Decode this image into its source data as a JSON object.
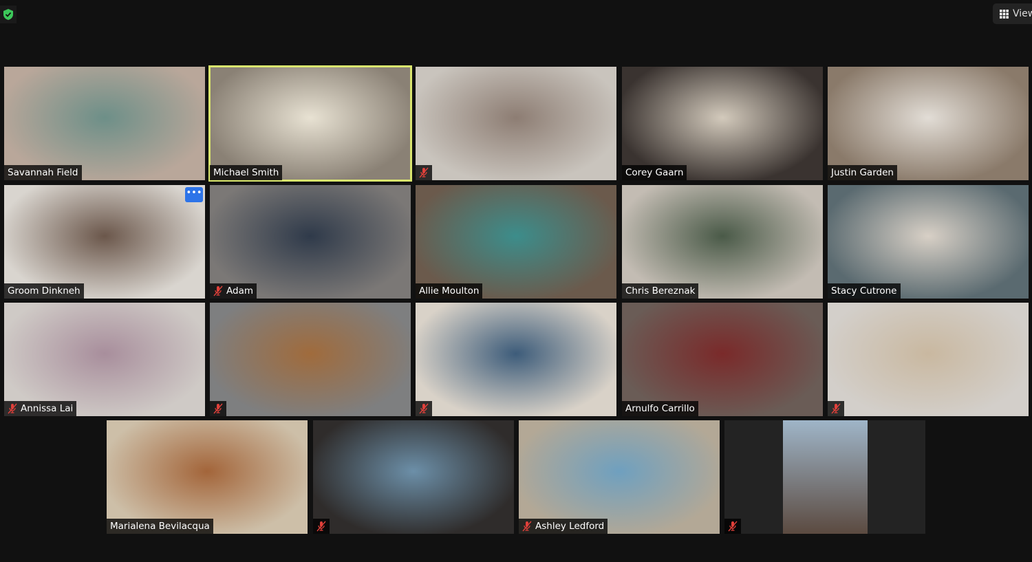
{
  "header": {
    "view_label": "View",
    "security_icon": "shield-check-icon",
    "view_icon": "grid-icon"
  },
  "colors": {
    "active_speaker": "#d9e56e",
    "muted": "#e0403a",
    "more_button": "#2d74e8",
    "shield": "#3cc85a"
  },
  "participants": [
    {
      "name": "Savannah Field",
      "muted": false,
      "bg": [
        "#b9a79a",
        "#6d8f88"
      ]
    },
    {
      "name": "Michael Smith",
      "muted": false,
      "active": true,
      "bg": [
        "#8a8175",
        "#e8e2d3"
      ]
    },
    {
      "name": "",
      "muted": true,
      "bg": [
        "#c9c4bd",
        "#8d7d73"
      ]
    },
    {
      "name": "Corey Gaarn",
      "muted": false,
      "bg": [
        "#3a3330",
        "#d3cabc"
      ]
    },
    {
      "name": "Justin Garden",
      "muted": false,
      "bg": [
        "#8a7a6a",
        "#e2ddd6"
      ]
    },
    {
      "name": "Groom Dinkneh",
      "muted": false,
      "more": true,
      "more_label": "•••",
      "bg": [
        "#d9d5cf",
        "#6b574b"
      ]
    },
    {
      "name": "Adam",
      "muted": true,
      "bg": [
        "#7b7876",
        "#2f3a4a"
      ]
    },
    {
      "name": "Allie Moulton",
      "muted": false,
      "bg": [
        "#6b5a4c",
        "#3c8d8b"
      ]
    },
    {
      "name": "Chris Bereznak",
      "muted": false,
      "bg": [
        "#c3bcb3",
        "#4a5a48"
      ]
    },
    {
      "name": "Stacy Cutrone",
      "muted": false,
      "bg": [
        "#5a6a70",
        "#d8d0c6"
      ]
    },
    {
      "name": "Annissa Lai",
      "muted": true,
      "bg": [
        "#cfcac6",
        "#a88e9c"
      ]
    },
    {
      "name": "",
      "muted": true,
      "bg": [
        "#7e7f80",
        "#a06b3c"
      ]
    },
    {
      "name": "",
      "muted": true,
      "bg": [
        "#d9d2c8",
        "#3d5c7a"
      ]
    },
    {
      "name": "Arnulfo Carrillo",
      "muted": false,
      "bg": [
        "#6a5c56",
        "#7a2a2a"
      ]
    },
    {
      "name": "",
      "muted": true,
      "bg": [
        "#d3cfca",
        "#c9b8a0"
      ]
    },
    {
      "name": "Marialena Bevilacqua",
      "muted": false,
      "bg": [
        "#cdbfa8",
        "#a3653a"
      ]
    },
    {
      "name": "",
      "muted": true,
      "bg": [
        "#2f2c2b",
        "#6c8fa8"
      ]
    },
    {
      "name": "Ashley Ledford",
      "muted": true,
      "bg": [
        "#b3a896",
        "#6fa0bf"
      ]
    },
    {
      "name": "",
      "muted": true,
      "inset": true,
      "bg": [
        "#9fb5c8",
        "#5b4a40"
      ]
    }
  ]
}
